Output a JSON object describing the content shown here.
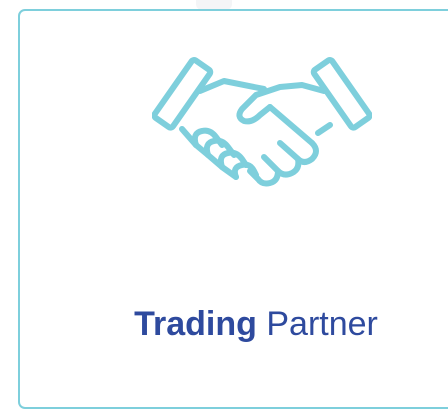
{
  "card": {
    "title_strong": "Trading",
    "title_light": "Partner",
    "border_color": "#7ecfdc",
    "title_color": "#2e4a9e",
    "icon": "handshake-icon",
    "icon_color": "#7ecfdc"
  }
}
